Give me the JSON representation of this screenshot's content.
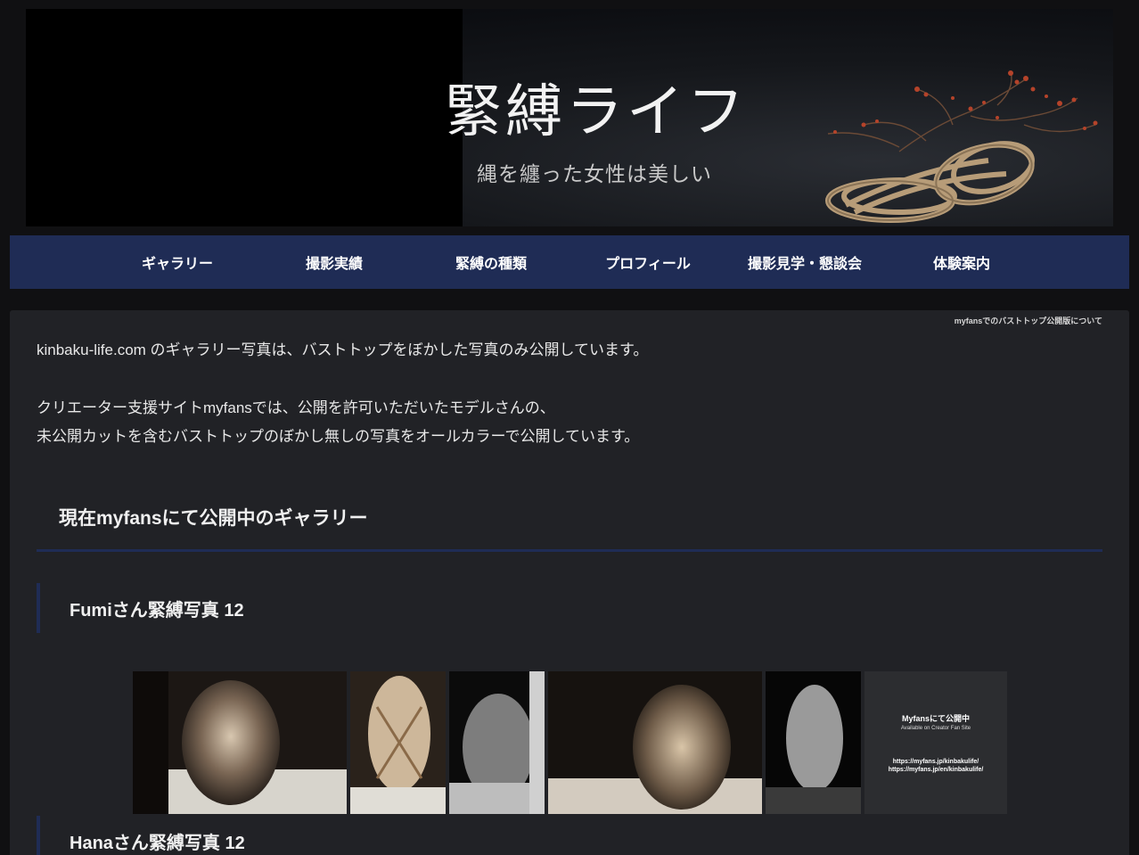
{
  "header": {
    "title": "緊縛ライフ",
    "subtitle": "縄を纏った女性は美しい"
  },
  "nav": {
    "items": [
      {
        "label": "ギャラリー"
      },
      {
        "label": "撮影実績"
      },
      {
        "label": "緊縛の種類"
      },
      {
        "label": "プロフィール"
      },
      {
        "label": "撮影見学・懇談会"
      },
      {
        "label": "体験案内"
      }
    ]
  },
  "breadcrumb": "myfansでのバストトップ公開版について",
  "intro": {
    "line1": "kinbaku-life.com のギャラリー写真は、バストトップをぼかした写真のみ公開しています。",
    "line2": "クリエーター支援サイトmyfansでは、公開を許可いただいたモデルさんの、",
    "line3": "未公開カットを含むバストトップのぼかし無しの写真をオールカラーで公開しています。"
  },
  "section": {
    "heading": "現在myfansにて公開中のギャラリー"
  },
  "galleries": [
    {
      "title": "Fumiさん緊縛写真 12"
    },
    {
      "title": "Hanaさん緊縛写真 12"
    }
  ],
  "promo": {
    "title": "Myfansにて公開中",
    "subtitle": "Available on Creator Fan Site",
    "url1": "https://myfans.jp/kinbakulife/",
    "url2": "https://myfans.jp/en/kinbakulife/"
  },
  "colors": {
    "nav_bg": "#1f2c55",
    "card_bg": "#212226",
    "page_bg": "#101012"
  }
}
